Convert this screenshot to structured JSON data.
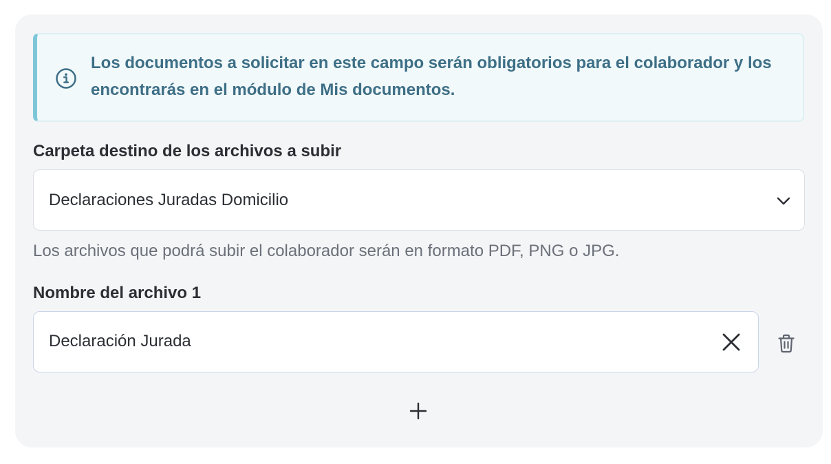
{
  "alert": {
    "icon": "info-icon",
    "message": "Los documentos a solicitar en este campo serán obligatorios para el colaborador y los encontrarás en el módulo de Mis documentos.",
    "accent_color": "#7dc7d8",
    "text_color": "#3d6f86"
  },
  "folder": {
    "label": "Carpeta destino de los archivos a subir",
    "selected": "Declaraciones Juradas Domicilio",
    "icon": "chevron-down-icon",
    "helper": "Los archivos que podrá subir el colaborador serán en formato PDF, PNG o JPG."
  },
  "files": [
    {
      "label": "Nombre del archivo 1",
      "value": "Declaración Jurada",
      "clear_icon": "close-icon",
      "delete_icon": "trash-icon"
    }
  ],
  "add_icon": "plus-icon"
}
